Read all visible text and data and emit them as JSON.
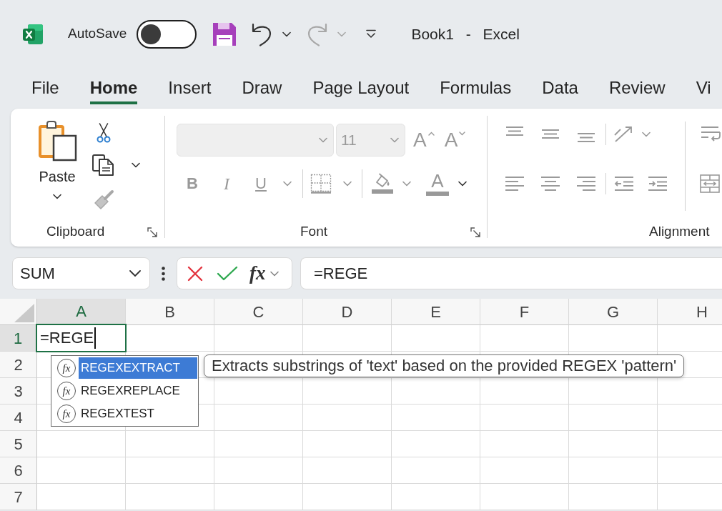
{
  "title_bar": {
    "autosave_label": "AutoSave",
    "autosave_on": false,
    "document_title": "Book1 - Excel"
  },
  "ribbon_tabs": [
    {
      "label": "File",
      "selected": false
    },
    {
      "label": "Home",
      "selected": true
    },
    {
      "label": "Insert",
      "selected": false
    },
    {
      "label": "Draw",
      "selected": false
    },
    {
      "label": "Page Layout",
      "selected": false
    },
    {
      "label": "Formulas",
      "selected": false
    },
    {
      "label": "Data",
      "selected": false
    },
    {
      "label": "Review",
      "selected": false
    },
    {
      "label": "Vi",
      "selected": false
    }
  ],
  "ribbon": {
    "clipboard": {
      "label": "Clipboard",
      "paste_label": "Paste"
    },
    "font": {
      "label": "Font",
      "disabled": true,
      "font_size": "11",
      "grow_label": "A",
      "shrink_label": "A",
      "bold_label": "B",
      "italic_label": "I",
      "underline_label": "U",
      "font_color_label": "A"
    },
    "alignment": {
      "label": "Alignment",
      "disabled": true
    }
  },
  "formula_bar": {
    "name_box": "SUM",
    "insert_function_label": "fx",
    "formula": "=REGE"
  },
  "sheet": {
    "columns": [
      {
        "label": "A",
        "selected": true
      },
      {
        "label": "B",
        "selected": false
      },
      {
        "label": "C",
        "selected": false
      },
      {
        "label": "D",
        "selected": false
      },
      {
        "label": "E",
        "selected": false
      },
      {
        "label": "F",
        "selected": false
      },
      {
        "label": "G",
        "selected": false
      },
      {
        "label": "H",
        "selected": false
      }
    ],
    "rows": [
      {
        "label": "1",
        "selected": true
      },
      {
        "label": "2",
        "selected": false
      },
      {
        "label": "3",
        "selected": false
      },
      {
        "label": "4",
        "selected": false
      },
      {
        "label": "5",
        "selected": false
      },
      {
        "label": "6",
        "selected": false
      },
      {
        "label": "7",
        "selected": false
      }
    ],
    "active_cell_value": "=REGE"
  },
  "autocomplete": {
    "items": [
      {
        "icon_label": "fx",
        "label": "REGEXEXTRACT",
        "selected": true
      },
      {
        "icon_label": "fx",
        "label": "REGEXREPLACE",
        "selected": false
      },
      {
        "icon_label": "fx",
        "label": "REGEXTEST",
        "selected": false
      }
    ],
    "tooltip": "Extracts substrings of 'text' based on the provided REGEX 'pattern'"
  }
}
